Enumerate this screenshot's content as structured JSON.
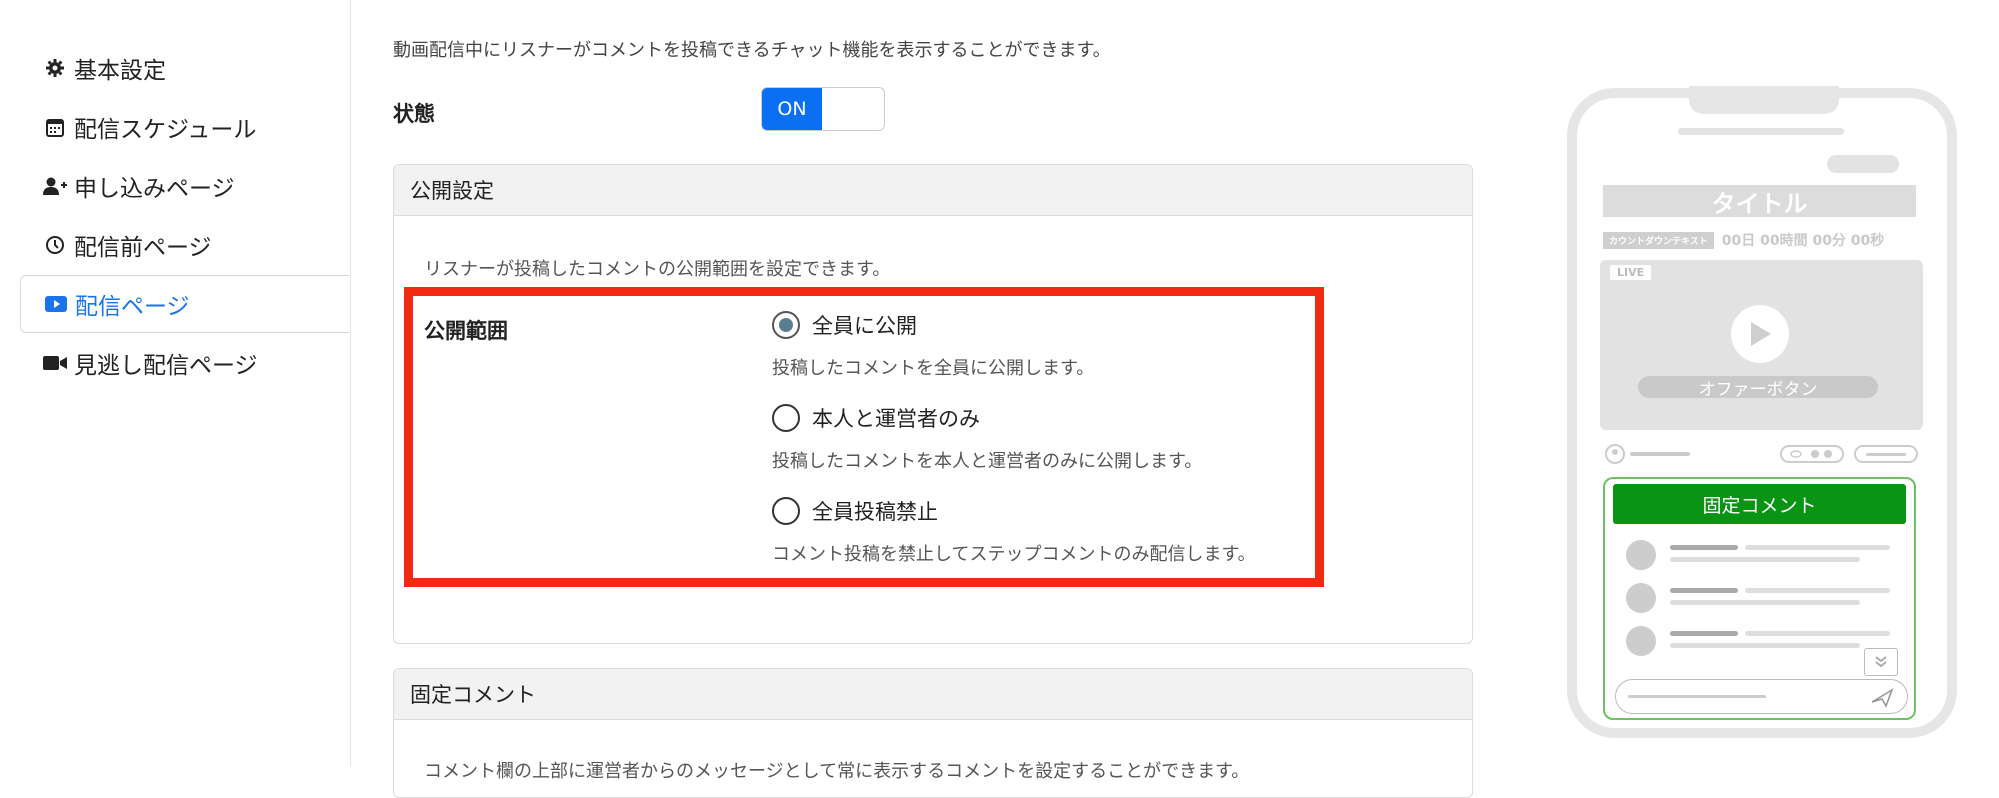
{
  "sidebar": {
    "items": [
      {
        "label": "基本設定",
        "icon": "gear-icon"
      },
      {
        "label": "配信スケジュール",
        "icon": "calendar-icon"
      },
      {
        "label": "申し込みページ",
        "icon": "user-plus-icon"
      },
      {
        "label": "配信前ページ",
        "icon": "clock-icon"
      },
      {
        "label": "配信ページ",
        "icon": "play-video-icon",
        "active": true
      },
      {
        "label": "見逃し配信ページ",
        "icon": "video-camera-icon"
      }
    ]
  },
  "main": {
    "description": "動画配信中にリスナーがコメントを投稿できるチャット機能を表示することができます。",
    "state_label": "状態",
    "toggle_on": "ON",
    "public_settings": {
      "header": "公開設定",
      "description": "リスナーが投稿したコメントの公開範囲を設定できます。",
      "scope_label": "公開範囲",
      "options": [
        {
          "label": "全員に公開",
          "description": "投稿したコメントを全員に公開します。",
          "selected": true
        },
        {
          "label": "本人と運営者のみ",
          "description": "投稿したコメントを本人と運営者のみに公開します。",
          "selected": false
        },
        {
          "label": "全員投稿禁止",
          "description": "コメント投稿を禁止してステップコメントのみ配信します。",
          "selected": false
        }
      ]
    },
    "fixed_comment": {
      "header": "固定コメント",
      "description": "コメント欄の上部に運営者からのメッセージとして常に表示するコメントを設定することができます。"
    }
  },
  "preview": {
    "title": "タイトル",
    "countdown_badge": "カウントダウンテキスト",
    "countdown_text": "00日 00時間 00分 00秒",
    "live_badge": "LIVE",
    "offer_button": "オファーボタン",
    "fixed_comment_button": "固定コメント"
  },
  "colors": {
    "accent": "#0b6ff2",
    "highlight": "#f12a12",
    "fixed_comment_green": "#0a9413"
  }
}
